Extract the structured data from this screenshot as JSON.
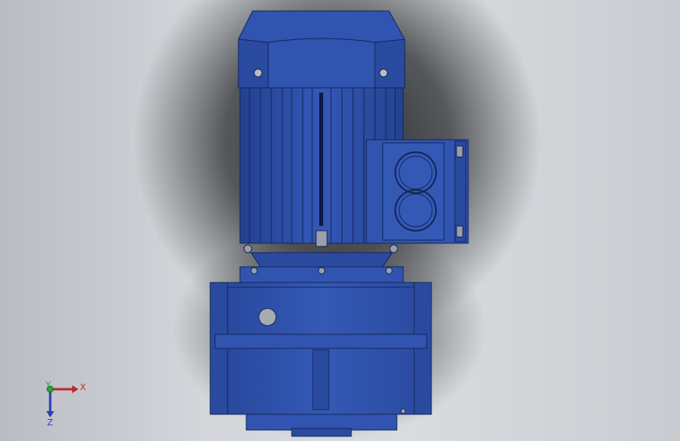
{
  "viewport": {
    "background_color": "#d5d8dc",
    "model": "gear-motor",
    "model_color": "#2f4fa8",
    "shadow_color": "#2a2c30"
  },
  "triad": {
    "x_label": "X",
    "y_label": "Y",
    "z_label": "Z",
    "x_color": "#c0282a",
    "y_color": "#2ea043",
    "z_color": "#2b3fb5"
  }
}
